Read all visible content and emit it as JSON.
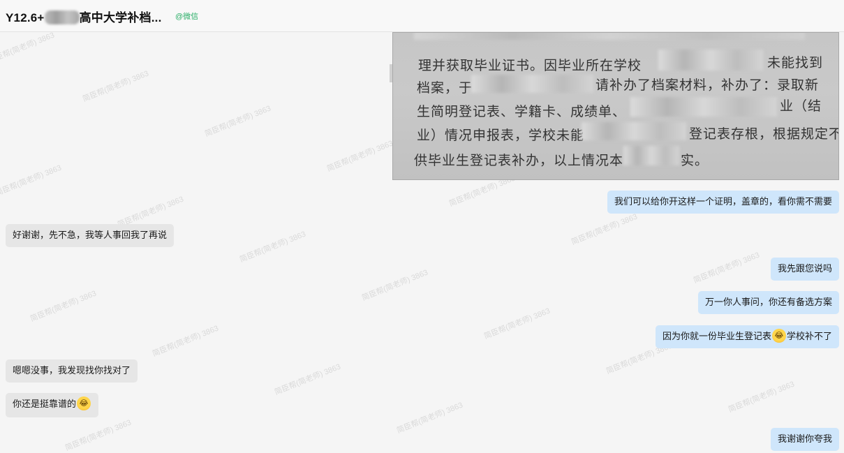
{
  "header": {
    "title_prefix": "Y12.6+",
    "title_suffix": "高中大学补档...",
    "source_tag": "@微信"
  },
  "watermark_text": "简臣帮(简老师) 3863",
  "photo": {
    "lines": [
      "理并获取毕业证书。因毕业所在学校",
      "档案，于",
      "请补办了档案材料，补办了：录取新",
      "生简明登记表、学籍卡、成绩单、",
      "业（结",
      "业）情况申报表，学校未能",
      "登记表存根，根据规定不提",
      "供毕业生登记表补办，以上情况本",
      "实。",
      "未能找到"
    ]
  },
  "messages": [
    {
      "dir": "out",
      "text": "我们可以给你开这样一个证明，盖章的，看你需不需要"
    },
    {
      "dir": "in",
      "text": "好谢谢，先不急，我等人事回我了再说"
    },
    {
      "dir": "out",
      "text": "我先跟您说吗"
    },
    {
      "dir": "out",
      "text": "万一你人事问，你还有备选方案"
    },
    {
      "dir": "out",
      "text_before": "因为你就一份毕业生登记表",
      "emoji": "laughing-tears-emoji",
      "text_after": "学校补不了"
    },
    {
      "dir": "in",
      "text": "嗯嗯没事，我发现找你找对了"
    },
    {
      "dir": "in",
      "text_before": "你还是挺靠谱的",
      "emoji": "laughing-tears-emoji"
    },
    {
      "dir": "out",
      "text": "我谢谢你夸我"
    }
  ]
}
